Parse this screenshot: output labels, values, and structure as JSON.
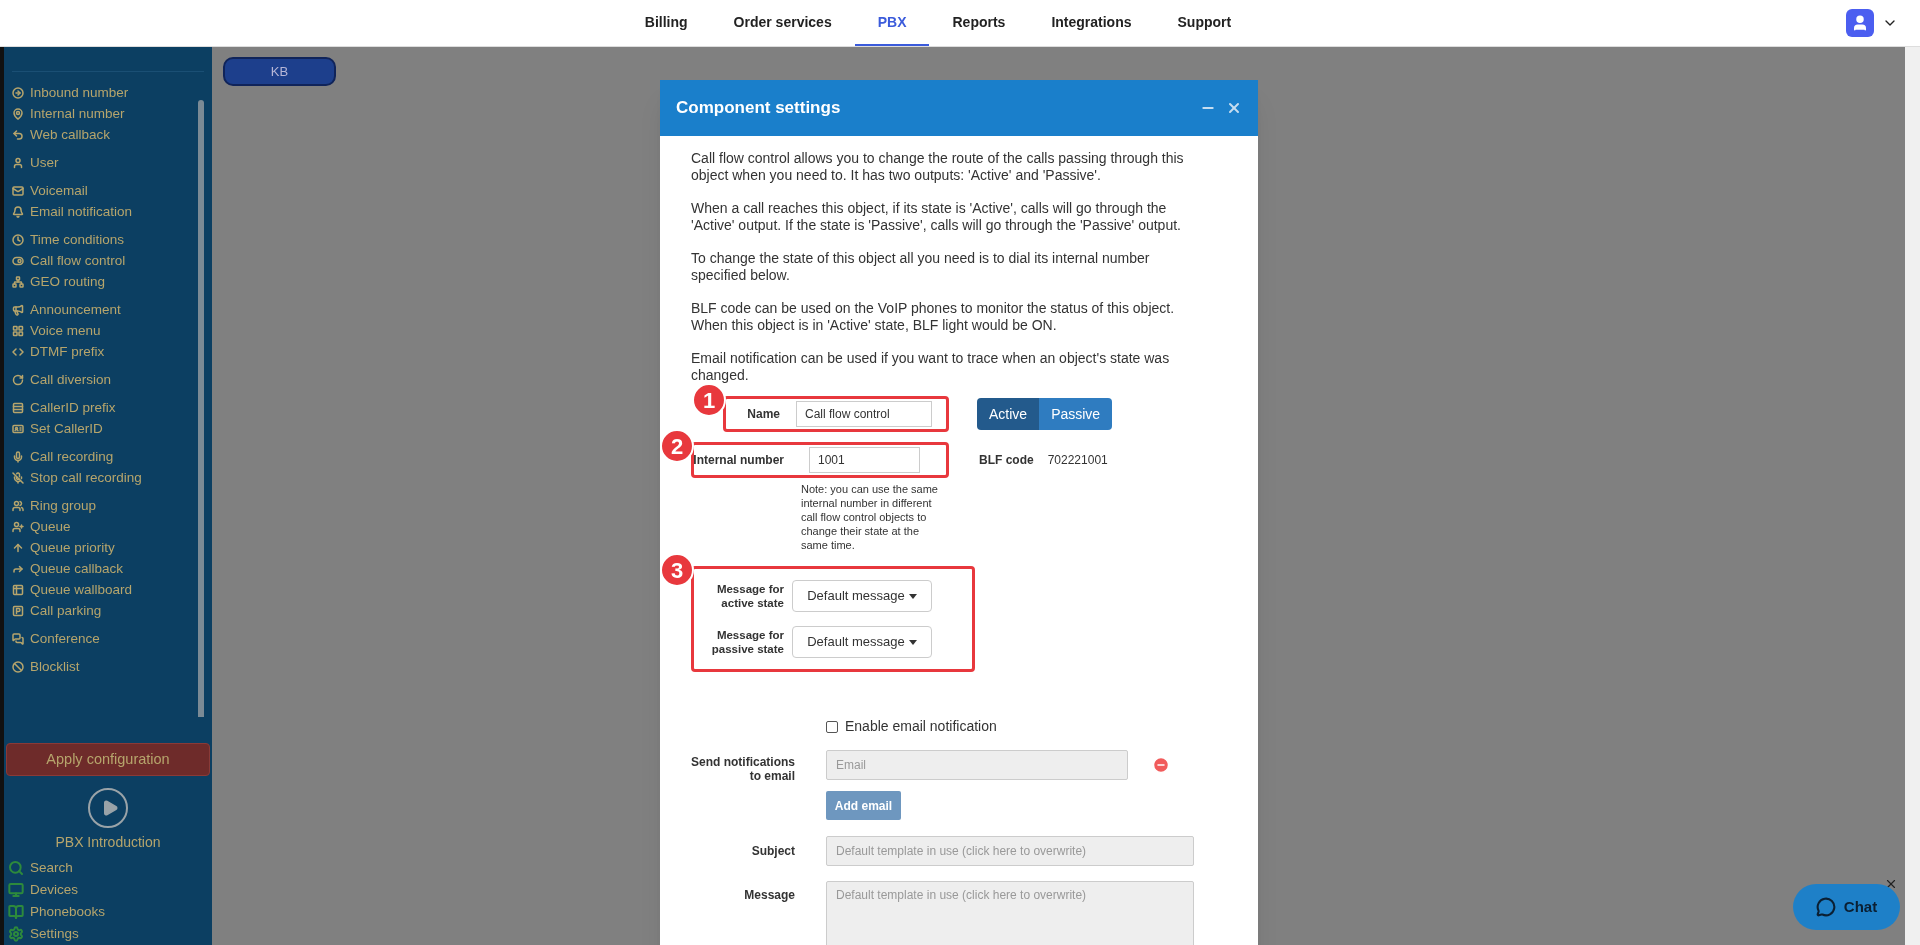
{
  "nav": {
    "tabs": [
      {
        "label": "Billing",
        "selected": false
      },
      {
        "label": "Order services",
        "selected": false
      },
      {
        "label": "PBX",
        "selected": true
      },
      {
        "label": "Reports",
        "selected": false
      },
      {
        "label": "Integrations",
        "selected": false
      },
      {
        "label": "Support",
        "selected": false
      }
    ]
  },
  "sidebar": {
    "groups": [
      [
        "Inbound number",
        "Internal number",
        "Web callback"
      ],
      [
        "User"
      ],
      [
        "Voicemail",
        "Email notification"
      ],
      [
        "Time conditions",
        "Call flow control",
        "GEO routing"
      ],
      [
        "Announcement",
        "Voice menu",
        "DTMF prefix"
      ],
      [
        "Call diversion"
      ],
      [
        "CallerID prefix",
        "Set CallerID"
      ],
      [
        "Call recording",
        "Stop call recording"
      ],
      [
        "Ring group",
        "Queue",
        "Queue priority",
        "Queue callback",
        "Queue wallboard",
        "Call parking"
      ],
      [
        "Conference"
      ],
      [
        "Blocklist"
      ]
    ],
    "apply_button": "Apply configuration",
    "intro": "PBX Introduction",
    "tools": [
      "Search",
      "Devices",
      "Phonebooks",
      "Settings"
    ]
  },
  "canvas": {
    "button": "KB"
  },
  "dialog": {
    "title": "Component settings",
    "paragraphs": [
      "Call flow control allows you to change the route of the calls passing through this object when you need to. It has two outputs: 'Active' and 'Passive'.",
      "When a call reaches this object, if its state is 'Active', calls will go through the 'Active' output. If the state is 'Passive', calls will go through the 'Passive' output.",
      "To change the state of this object all you need is to dial its internal number specified below.",
      "BLF code can be used on the VoIP phones to monitor the status of this object. When this object is in 'Active' state, BLF light would be ON.",
      "Email notification can be used if you want to trace when an object's state was changed."
    ],
    "name": {
      "badge": "1",
      "label": "Name",
      "value": "Call flow control"
    },
    "states": [
      {
        "label": "Active",
        "selected": true
      },
      {
        "label": "Passive",
        "selected": false
      }
    ],
    "internal": {
      "badge": "2",
      "label": "Internal number",
      "value": "1001",
      "note": "Note: you can use the same internal number in different call flow control objects to change their state at the same time."
    },
    "blf": {
      "label": "BLF code",
      "value": "702221001"
    },
    "messages": {
      "badge": "3",
      "rows": [
        {
          "label": "Message for active state",
          "value": "Default message"
        },
        {
          "label": "Message for passive state",
          "value": "Default message"
        }
      ]
    },
    "email_toggle": {
      "label": "Enable email notification",
      "checked": false
    },
    "send_label": "Send notifications to email",
    "email": {
      "placeholder": "Email"
    },
    "add_email": "Add email",
    "subject": {
      "label": "Subject",
      "placeholder": "Default template in use (click here to overwrite)"
    },
    "message": {
      "label": "Message",
      "placeholder": "Default template in use (click here to overwrite)"
    }
  },
  "chat": {
    "label": "Chat"
  }
}
